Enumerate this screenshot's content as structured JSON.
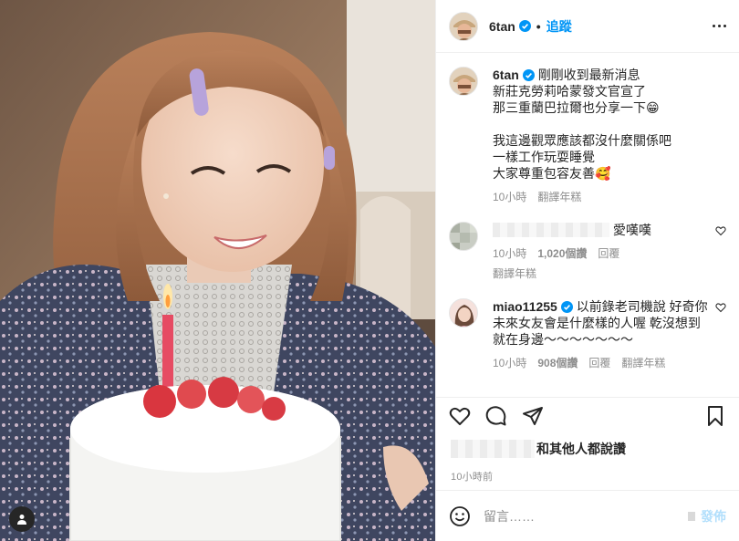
{
  "header": {
    "username": "6tan",
    "separator": "•",
    "follow_label": "追蹤"
  },
  "caption": {
    "username": "6tan",
    "text": "剛剛收到最新消息\n新莊克勞莉哈蒙發文官宣了\n那三重蘭巴拉爾也分享一下😁\n\n我這邊觀眾應該都沒什麼關係吧\n一樣工作玩耍睡覺\n大家尊重包容友善🥰",
    "time": "10小時",
    "translate_label": "翻譯年糕"
  },
  "comments": [
    {
      "username": "",
      "text": "愛嘆嘆",
      "time": "10小時",
      "likes": "1,020個讚",
      "reply_label": "回覆",
      "translate_label": "翻譯年糕"
    },
    {
      "username": "miao11255",
      "text": "以前錄老司機說 好奇你未來女友會是什麼樣的人喔 乾沒想到就在身邊～～～～～～～",
      "time": "10小時",
      "likes": "908個讚",
      "reply_label": "回覆",
      "translate_label": "翻譯年糕"
    }
  ],
  "likes_summary": {
    "text": "和其他人都說讚"
  },
  "post_time": "10小時前",
  "composer": {
    "placeholder": "留言……",
    "post_label": "發佈"
  },
  "colors": {
    "accent": "#0095f6",
    "post_disabled": "#b2dffc",
    "meta_gray": "#8e8e8e"
  },
  "icons": [
    "verified-badge-icon",
    "more-options-icon",
    "heart-icon",
    "comment-icon",
    "share-icon",
    "bookmark-icon",
    "emoji-icon",
    "user-tag-icon"
  ]
}
